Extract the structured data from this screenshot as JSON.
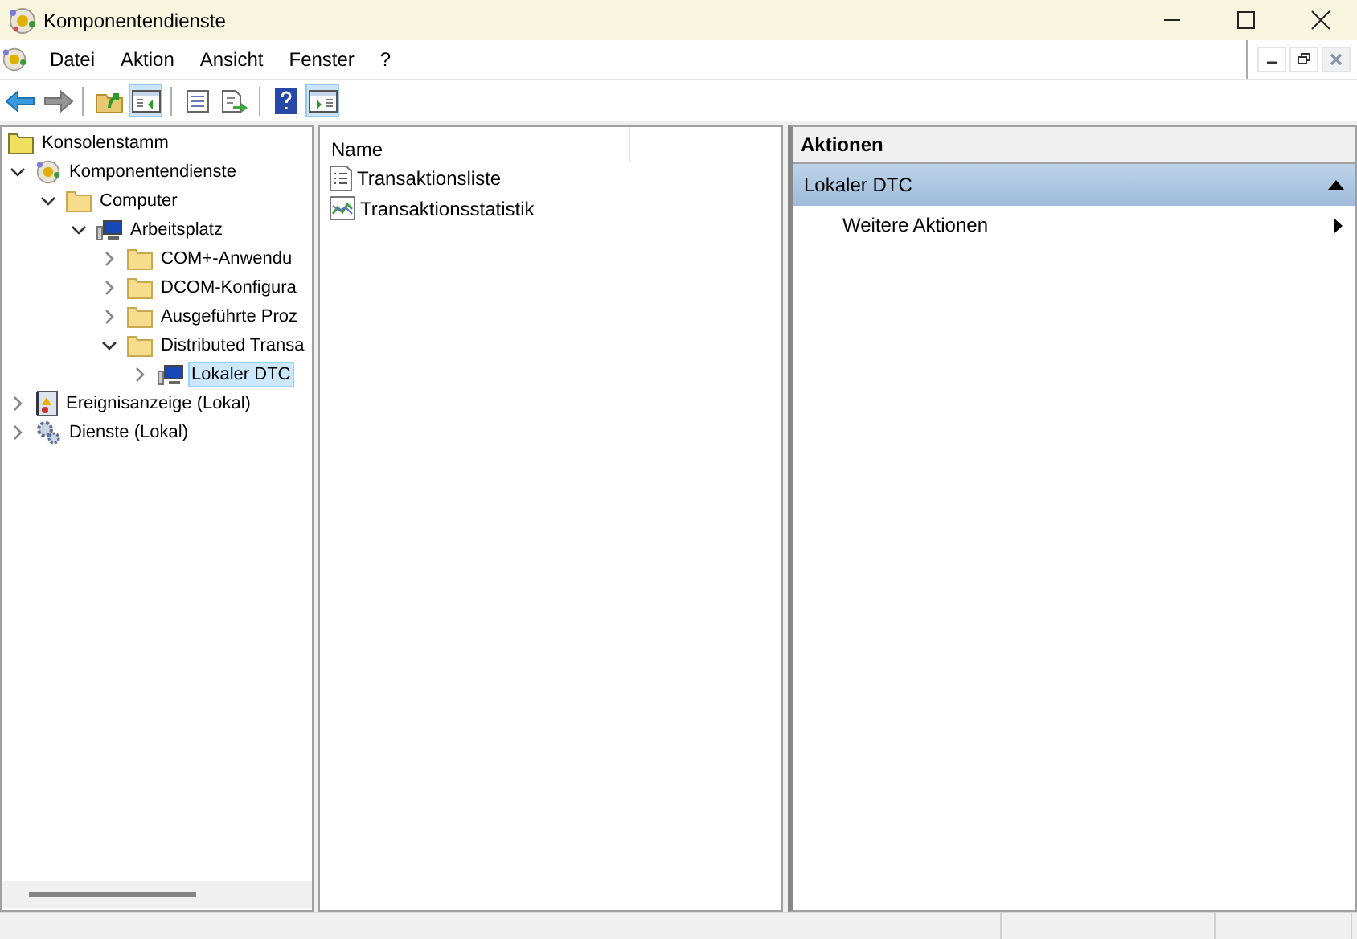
{
  "window": {
    "title": "Komponentendienste"
  },
  "menu": [
    {
      "label": "Datei"
    },
    {
      "label": "Aktion"
    },
    {
      "label": "Ansicht"
    },
    {
      "label": "Fenster"
    },
    {
      "label": "?"
    }
  ],
  "toolbar": [
    {
      "kind": "back",
      "on": false,
      "disabled": false
    },
    {
      "kind": "forward",
      "on": false,
      "disabled": true
    },
    {
      "kind": "sep"
    },
    {
      "kind": "up",
      "on": false,
      "disabled": false
    },
    {
      "kind": "tree",
      "on": true,
      "disabled": false
    },
    {
      "kind": "sep"
    },
    {
      "kind": "properties",
      "on": false,
      "disabled": false
    },
    {
      "kind": "export",
      "on": false,
      "disabled": false
    },
    {
      "kind": "sep"
    },
    {
      "kind": "help",
      "on": false,
      "disabled": false
    },
    {
      "kind": "actionpane",
      "on": true,
      "disabled": false
    }
  ],
  "tree": {
    "root": {
      "label": "Konsolenstamm",
      "kind": "rootfolder"
    },
    "items": [
      {
        "label": "Komponentendienste",
        "kind": "snapin",
        "expanded": true,
        "selected": false,
        "children": [
          {
            "label": "Computer",
            "kind": "folder",
            "expanded": true,
            "selected": false,
            "children": [
              {
                "label": "Arbeitsplatz",
                "kind": "computer",
                "expanded": true,
                "selected": false,
                "children": [
                  {
                    "label": "COM+-Anwendu",
                    "kind": "folder",
                    "expanded": false,
                    "selected": false
                  },
                  {
                    "label": "DCOM-Konfigura",
                    "kind": "folder",
                    "expanded": false,
                    "selected": false
                  },
                  {
                    "label": "Ausgeführte Proz",
                    "kind": "folder",
                    "expanded": false,
                    "selected": false
                  },
                  {
                    "label": "Distributed Transa",
                    "kind": "folder",
                    "expanded": true,
                    "selected": false,
                    "children": [
                      {
                        "label": "Lokaler DTC",
                        "kind": "computer",
                        "expanded": false,
                        "selected": true
                      }
                    ]
                  }
                ]
              }
            ]
          }
        ]
      },
      {
        "label": "Ereignisanzeige (Lokal)",
        "kind": "eventlog",
        "expanded": false,
        "selected": false
      },
      {
        "label": "Dienste (Lokal)",
        "kind": "gear",
        "expanded": false,
        "selected": false
      }
    ]
  },
  "list": {
    "columns": [
      "Name"
    ],
    "rows": [
      {
        "name": "Transaktionsliste",
        "kind": "list"
      },
      {
        "name": "Transaktionsstatistik",
        "kind": "chart"
      }
    ]
  },
  "actions": {
    "title": "Aktionen",
    "sections": [
      {
        "title": "Lokaler DTC",
        "expanded": true,
        "items": [
          {
            "label": "Weitere Aktionen",
            "submenu": true
          }
        ]
      }
    ]
  }
}
